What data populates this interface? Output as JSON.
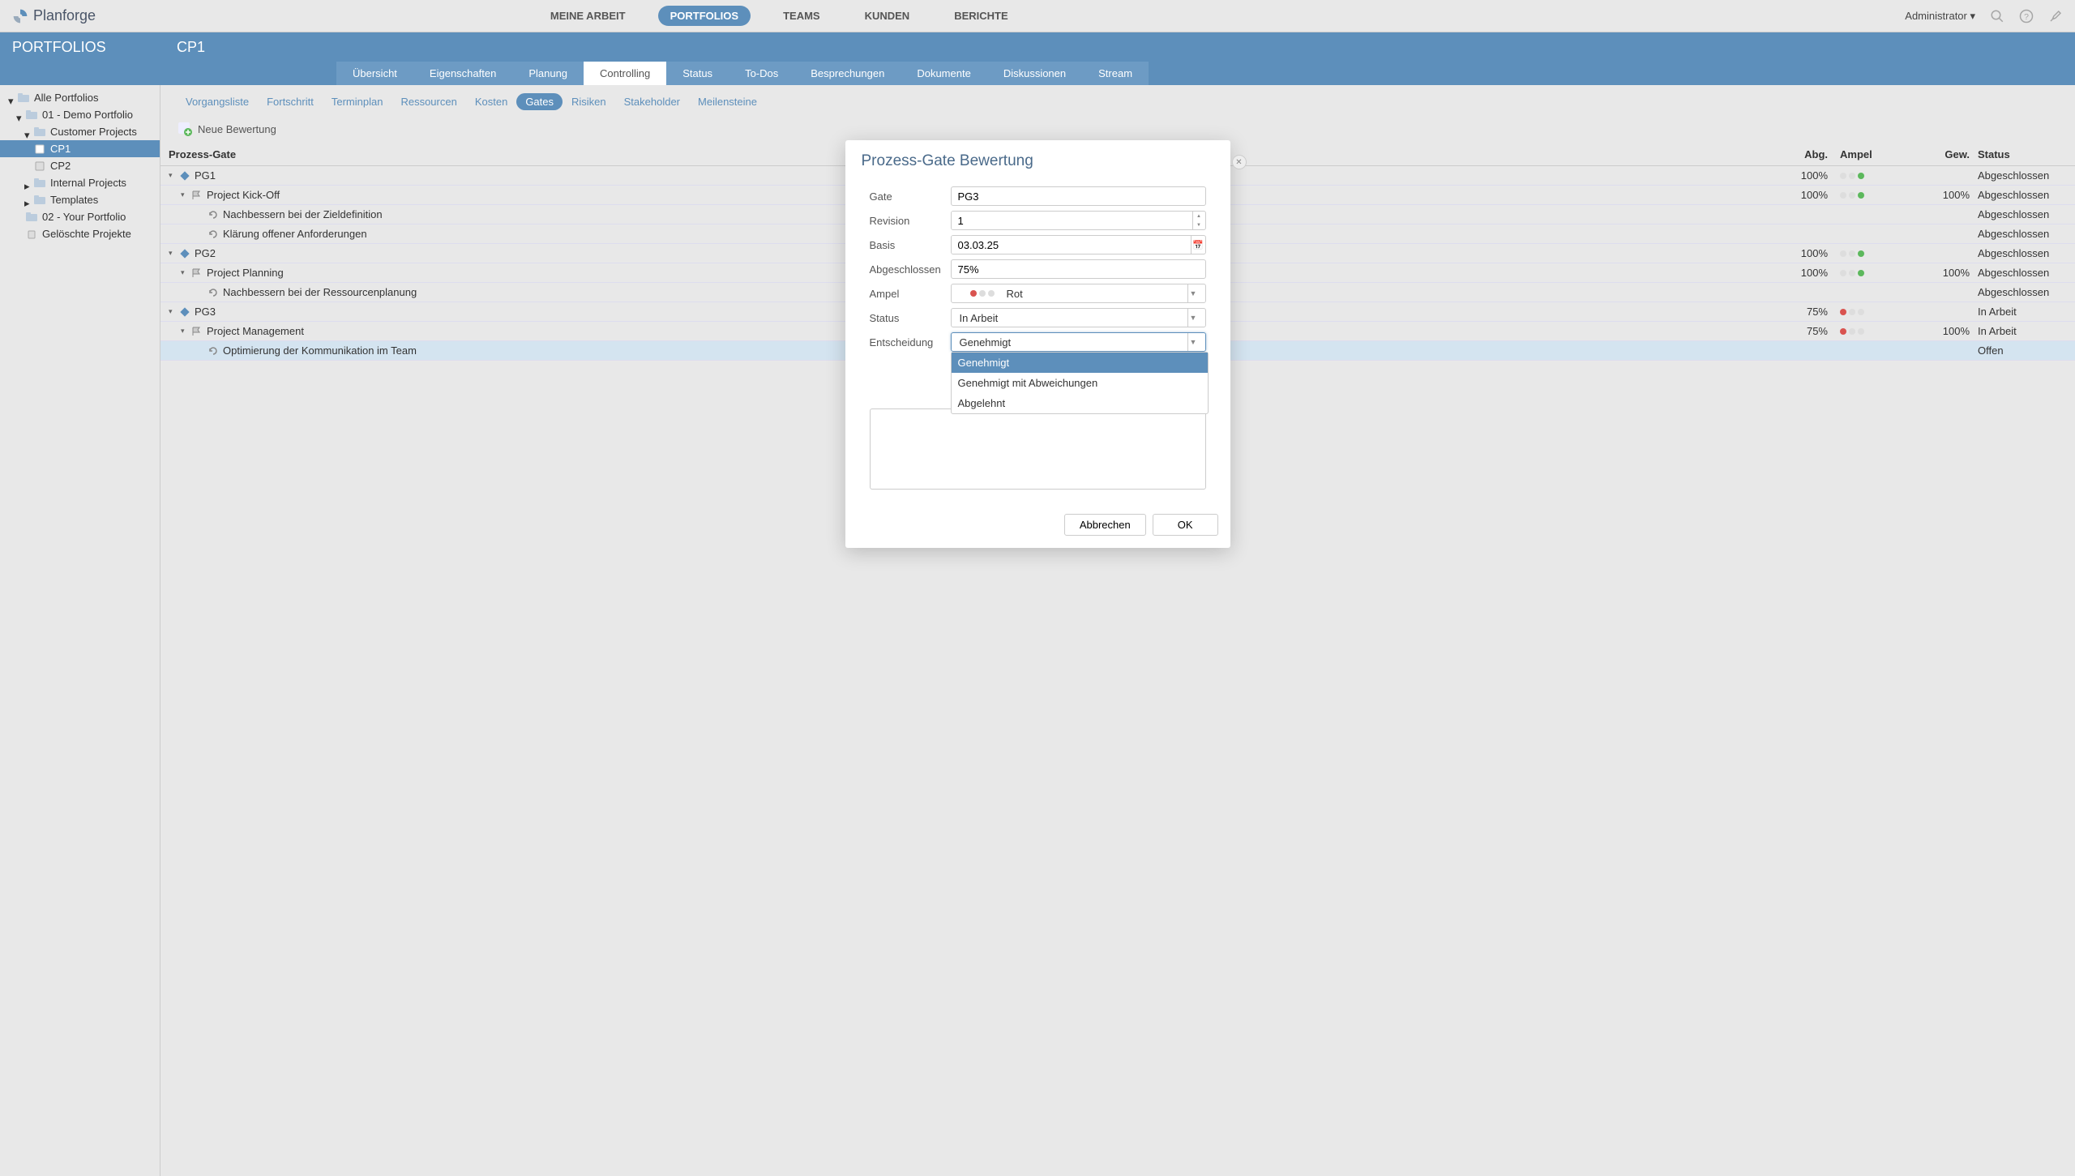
{
  "app_name": "Planforge",
  "main_nav": {
    "my_work": "MEINE ARBEIT",
    "portfolios": "PORTFOLIOS",
    "teams": "TEAMS",
    "customers": "KUNDEN",
    "reports": "BERICHTE"
  },
  "user": "Administrator",
  "portfolios_label": "PORTFOLIOS",
  "breadcrumb": "CP1",
  "sub_nav": {
    "overview": "Übersicht",
    "properties": "Eigenschaften",
    "planning": "Planung",
    "controlling": "Controlling",
    "status": "Status",
    "todos": "To-Dos",
    "meetings": "Besprechungen",
    "documents": "Dokumente",
    "discussions": "Diskussionen",
    "stream": "Stream"
  },
  "tertiary_nav": {
    "tasks": "Vorgangsliste",
    "progress": "Fortschritt",
    "schedule": "Terminplan",
    "resources": "Ressourcen",
    "costs": "Kosten",
    "gates": "Gates",
    "risks": "Risiken",
    "stakeholder": "Stakeholder",
    "milestones": "Meilensteine"
  },
  "action": {
    "new_rating": "Neue Bewertung"
  },
  "sidebar": {
    "all_portfolios": "Alle Portfolios",
    "demo_portfolio": "01 - Demo Portfolio",
    "customer_projects": "Customer Projects",
    "cp1": "CP1",
    "cp2": "CP2",
    "internal_projects": "Internal Projects",
    "templates": "Templates",
    "your_portfolio": "02 - Your Portfolio",
    "deleted": "Gelöschte Projekte"
  },
  "table": {
    "headers": {
      "process_gate": "Prozess-Gate",
      "completed": "Abg.",
      "traffic": "Ampel",
      "weight": "Gew.",
      "status": "Status"
    },
    "rows": [
      {
        "name": "PG1",
        "indent": 0,
        "abg": "100%",
        "ampel": "green",
        "gew": "",
        "status": "Abgeschlossen",
        "toggle": true,
        "icon": "diamond"
      },
      {
        "name": "Project Kick-Off",
        "indent": 1,
        "abg": "100%",
        "ampel": "green",
        "gew": "100%",
        "status": "Abgeschlossen",
        "toggle": true,
        "icon": "flag"
      },
      {
        "name": "Nachbessern bei der Zieldefinition",
        "indent": 2,
        "abg": "",
        "ampel": "",
        "gew": "",
        "status": "Abgeschlossen",
        "icon": "cycle"
      },
      {
        "name": "Klärung offener Anforderungen",
        "indent": 2,
        "abg": "",
        "ampel": "",
        "gew": "",
        "status": "Abgeschlossen",
        "icon": "cycle"
      },
      {
        "name": "PG2",
        "indent": 0,
        "abg": "100%",
        "ampel": "green",
        "gew": "",
        "status": "Abgeschlossen",
        "toggle": true,
        "icon": "diamond"
      },
      {
        "name": "Project Planning",
        "indent": 1,
        "abg": "100%",
        "ampel": "green",
        "gew": "100%",
        "status": "Abgeschlossen",
        "toggle": true,
        "icon": "flag"
      },
      {
        "name": "Nachbessern bei der Ressourcenplanung",
        "indent": 2,
        "abg": "",
        "ampel": "",
        "gew": "",
        "status": "Abgeschlossen",
        "icon": "cycle"
      },
      {
        "name": "PG3",
        "indent": 0,
        "abg": "75%",
        "ampel": "red",
        "gew": "",
        "status": "In Arbeit",
        "toggle": true,
        "icon": "diamond"
      },
      {
        "name": "Project Management",
        "indent": 1,
        "abg": "75%",
        "ampel": "red",
        "gew": "100%",
        "status": "In Arbeit",
        "toggle": true,
        "icon": "flag"
      },
      {
        "name": "Optimierung der Kommunikation im Team",
        "indent": 2,
        "abg": "",
        "ampel": "",
        "gew": "",
        "status": "Offen",
        "icon": "cycle",
        "highlight": true
      }
    ]
  },
  "modal": {
    "title": "Prozess-Gate Bewertung",
    "fields": {
      "gate_label": "Gate",
      "gate_value": "PG3",
      "revision_label": "Revision",
      "revision_value": "1",
      "basis_label": "Basis",
      "basis_value": "03.03.25",
      "completed_label": "Abgeschlossen",
      "completed_value": "75%",
      "traffic_label": "Ampel",
      "traffic_value": "Rot",
      "status_label": "Status",
      "status_value": "In Arbeit",
      "decision_label": "Entscheidung",
      "decision_value": "Genehmigt"
    },
    "dropdown_options": {
      "approved": "Genehmigt",
      "approved_deviation": "Genehmigt mit Abweichungen",
      "rejected": "Abgelehnt"
    },
    "buttons": {
      "cancel": "Abbrechen",
      "ok": "OK"
    }
  }
}
